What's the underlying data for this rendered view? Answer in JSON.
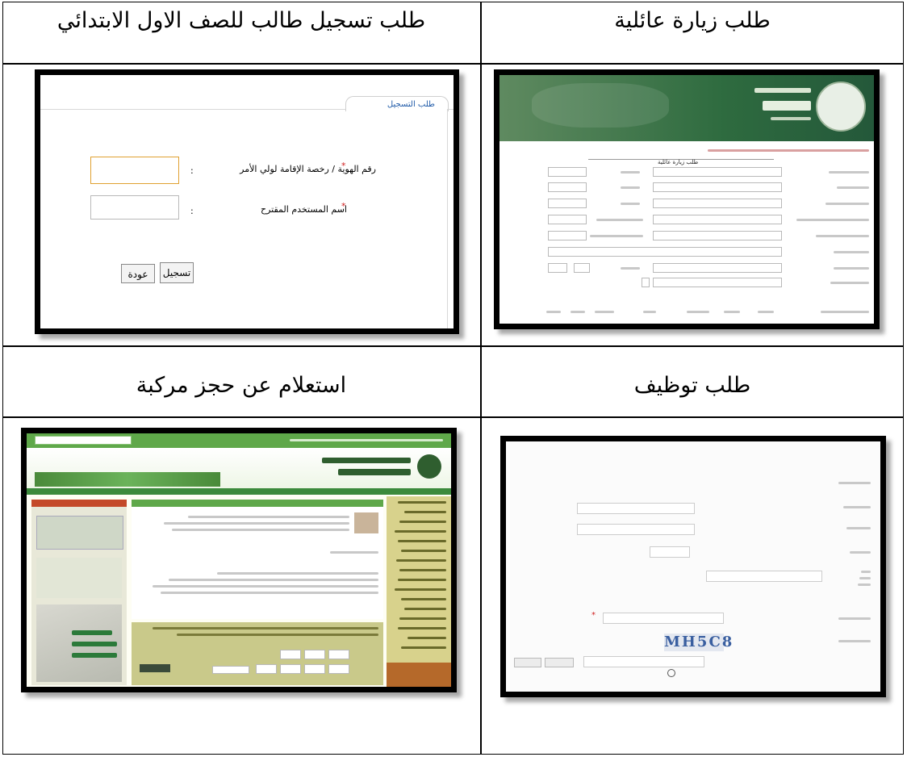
{
  "cells": {
    "top_right": {
      "title": "طلب زيارة عائلية"
    },
    "top_left": {
      "title": "طلب تسجيل طالب للصف الاول الابتدائي"
    },
    "bottom_right": {
      "title": "طلب توظيف"
    },
    "bottom_left": {
      "title": "استعلام عن حجز مركبة"
    }
  },
  "registration": {
    "tab_label": "طلب التسجيل",
    "id_label": "رقم الهوية / رخصة الإقامة لولي الأمر",
    "username_label": "اسم المستخدم المقترح",
    "colon": ":",
    "required_mark": "*",
    "register_button": "تسجيل",
    "back_button": "عودة"
  },
  "visit": {
    "form_title": "طلب زيارة عائلية"
  },
  "job": {
    "captcha_text": "MH5C8"
  },
  "colors": {
    "mofa_green": "#2e6b3f",
    "portal_green": "#5fa84a",
    "olive": "#c9c98a",
    "required_red": "#d02020"
  }
}
